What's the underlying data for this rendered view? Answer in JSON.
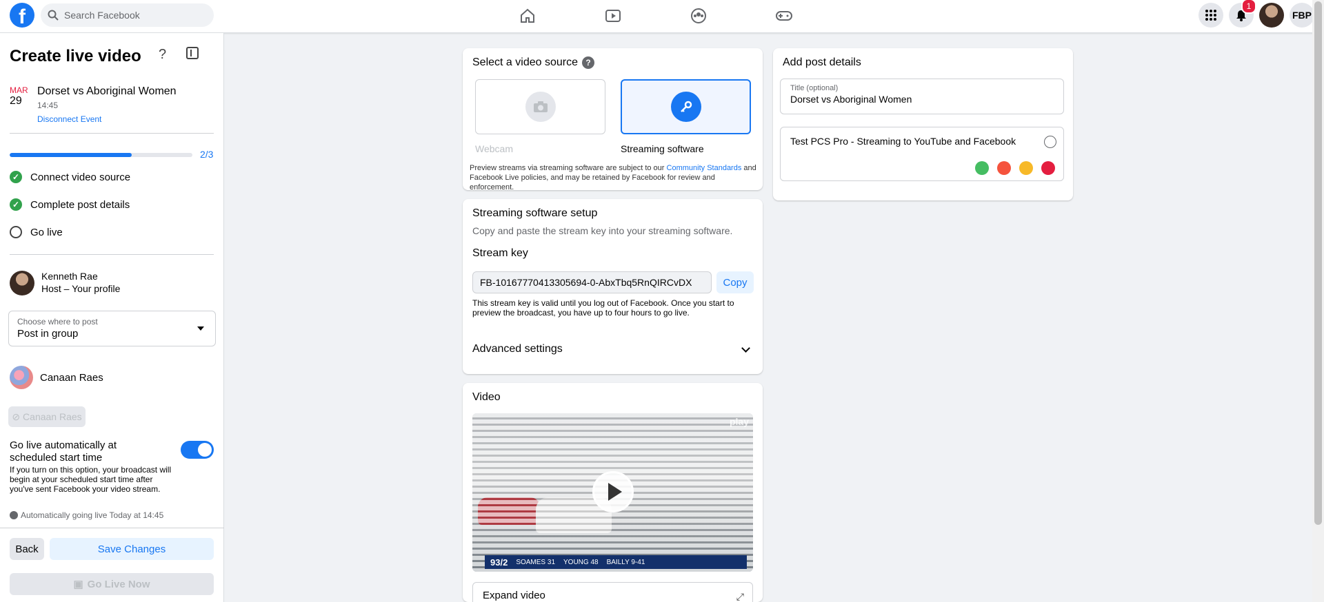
{
  "topbar": {
    "logo": "f",
    "search_placeholder": "Search Facebook",
    "notifications_count": "1",
    "profile_short": "FBP"
  },
  "sidebar": {
    "title": "Create live video",
    "help": "?",
    "event": {
      "month": "MAR",
      "day": "29",
      "name": "Dorset vs Aboriginal Women",
      "time": "14:45",
      "disconnect_label": "Disconnect Event"
    },
    "progress": {
      "label": "2/3",
      "fraction": 0.667
    },
    "steps": [
      {
        "label": "Connect video source",
        "done": true
      },
      {
        "label": "Complete post details",
        "done": true
      },
      {
        "label": "Go live",
        "done": false
      }
    ],
    "host": {
      "name": "Kenneth Rae",
      "role": "Host – Your profile"
    },
    "choose": {
      "label": "Choose where to post",
      "value": "Post in group"
    },
    "group": {
      "name": "Canaan Raes",
      "chip": "Canaan Raes"
    },
    "auto_live": {
      "title": "Go live automatically at scheduled start time",
      "description": "If you turn on this option, your broadcast will begin at your scheduled start time after you've sent Facebook your video stream.",
      "status": "Automatically going live Today at 14:45",
      "enabled": true
    },
    "buttons": {
      "back": "Back",
      "save": "Save Changes",
      "go_live": "Go Live Now"
    }
  },
  "source": {
    "title": "Select a video source",
    "options": [
      {
        "label": "Webcam",
        "selected": false,
        "icon": "camera-icon"
      },
      {
        "label": "Streaming software",
        "selected": true,
        "icon": "key-icon"
      }
    ],
    "note_before": "Preview streams via streaming software are subject to our ",
    "note_link": "Community Standards",
    "note_after": " and Facebook Live policies, and may be retained by Facebook for review and enforcement."
  },
  "setup": {
    "title": "Streaming software setup",
    "subtitle": "Copy and paste the stream key into your streaming software.",
    "key_label": "Stream key",
    "key_value": "FB-10167770413305694-0-AbxTbq5RnQIRCvDX",
    "copy_label": "Copy",
    "key_note": "This stream key is valid until you log out of Facebook. Once you start to preview the broadcast, you have up to four hours to go live.",
    "advanced_label": "Advanced settings"
  },
  "video": {
    "title": "Video",
    "watermark": "play",
    "score": "93/2",
    "batter": "SOAMES 31",
    "bowler": "YOUNG 48",
    "partner": "BAILLY 9-41",
    "expand_label": "Expand video"
  },
  "details": {
    "title": "Add post details",
    "title_field_label": "Title (optional)",
    "title_field_value": "Dorset vs Aboriginal Women",
    "post_text": "Test PCS Pro - Streaming to YouTube and Facebook"
  },
  "colors": {
    "brand": "#1877f2",
    "success": "#31a24c",
    "badge": "#e41e3f"
  }
}
